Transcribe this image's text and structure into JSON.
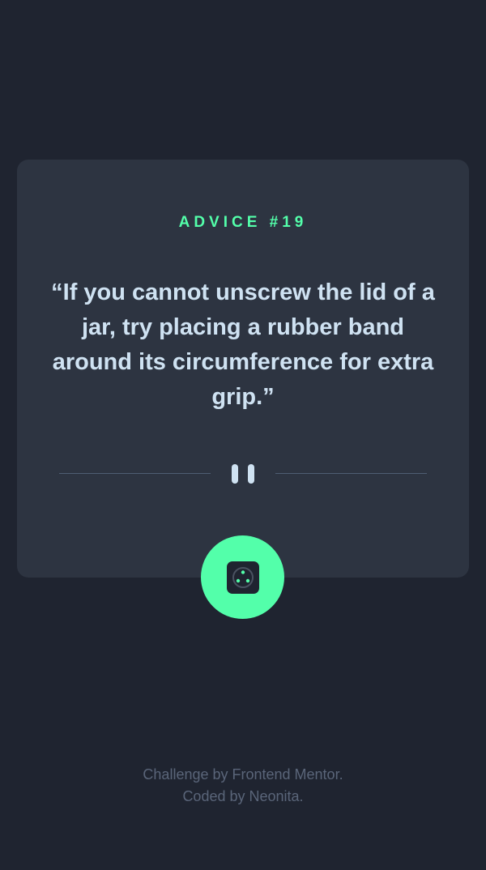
{
  "advice": {
    "label": "ADVICE #19",
    "text": "“If you cannot unscrew the lid of a jar, try placing a rubber band around its circumference for extra grip.”"
  },
  "footer": {
    "line1": "Challenge by Frontend Mentor.",
    "line2": "Coded by Neonita."
  },
  "icons": {
    "divider": "pause-icon",
    "button": "dice-icon"
  },
  "colors": {
    "background": "#1f2430",
    "card": "#2d3441",
    "accent": "#53ffaa",
    "quote_text": "#cfe2f2",
    "muted_text": "#5a6579",
    "divider": "#4e5d73"
  }
}
